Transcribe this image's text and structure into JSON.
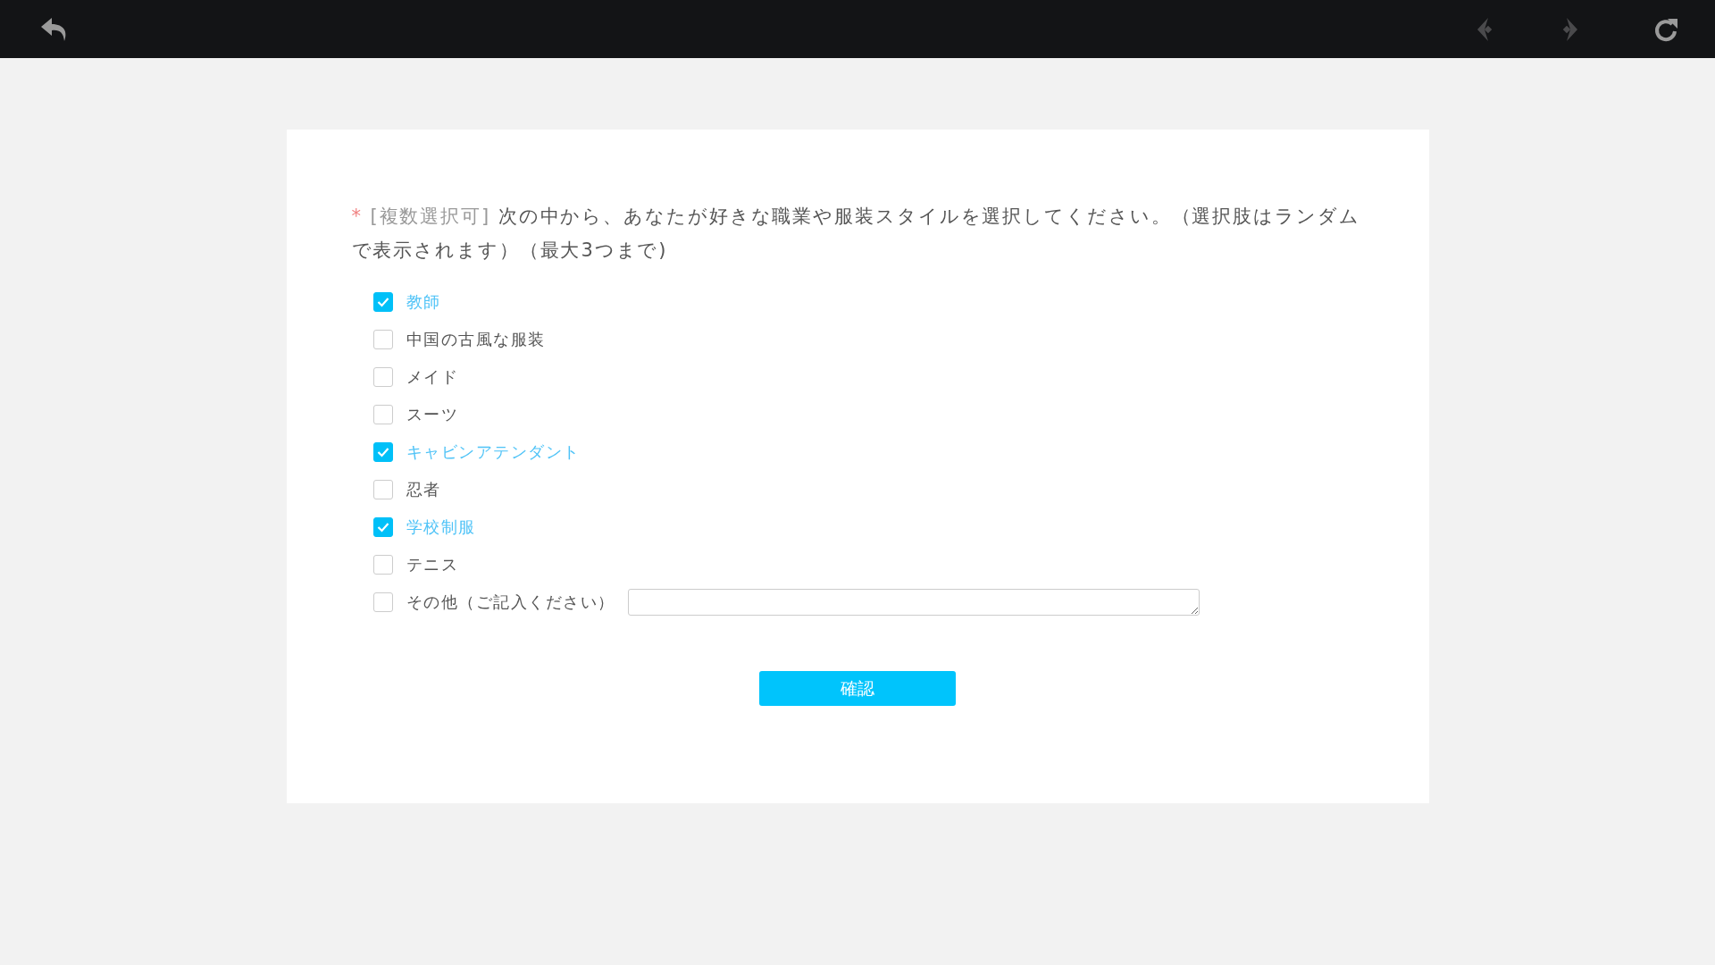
{
  "question": {
    "required_mark": "*",
    "tag": "[複数選択可]",
    "text": "次の中から、あなたが好きな職業や服装スタイルを選択してください。（選択肢はランダムで表示されます）（最大3つまで)"
  },
  "options": [
    {
      "label": "教師",
      "checked": true,
      "kind": "plain"
    },
    {
      "label": "中国の古風な服装",
      "checked": false,
      "kind": "plain"
    },
    {
      "label": "メイド",
      "checked": false,
      "kind": "plain"
    },
    {
      "label": "スーツ",
      "checked": false,
      "kind": "plain"
    },
    {
      "label": "キャビンアテンダント",
      "checked": true,
      "kind": "plain"
    },
    {
      "label": "忍者",
      "checked": false,
      "kind": "plain"
    },
    {
      "label": "学校制服",
      "checked": true,
      "kind": "plain"
    },
    {
      "label": "テニス",
      "checked": false,
      "kind": "plain"
    },
    {
      "label": "その他（ご記入ください）",
      "checked": false,
      "kind": "other"
    }
  ],
  "submit_button": "確認"
}
